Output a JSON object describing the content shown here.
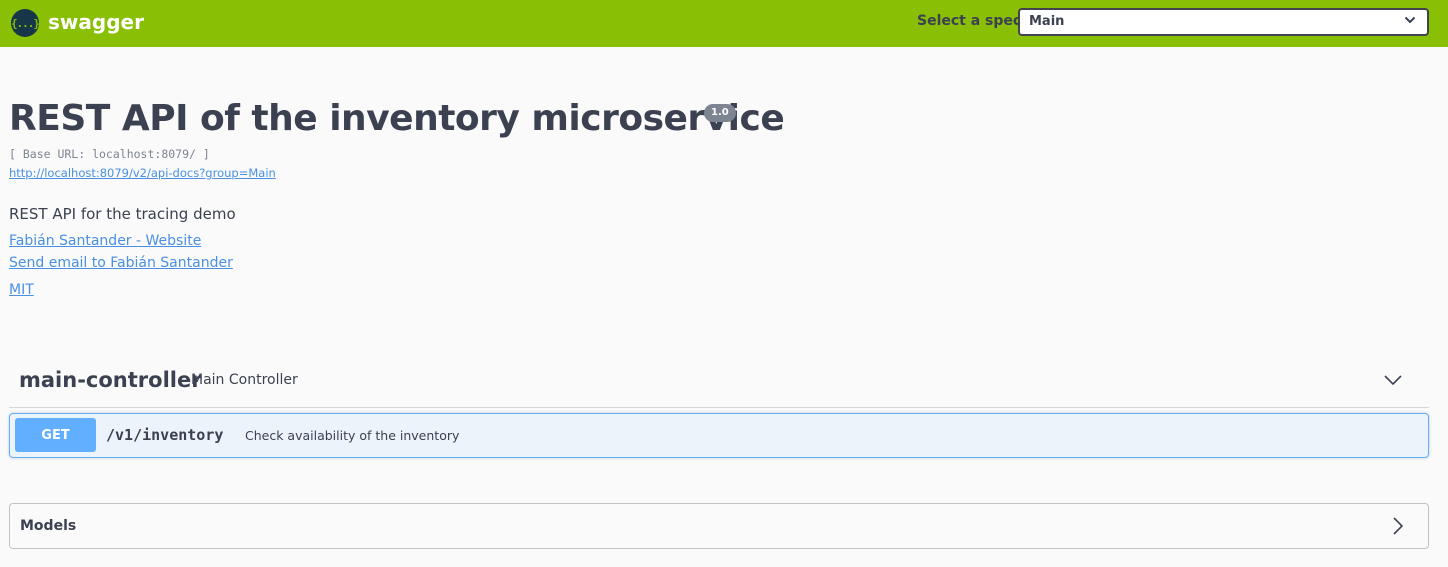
{
  "topbar": {
    "brand": "swagger",
    "logo_glyph": "{...}",
    "logo_icon": "swagger-logo-icon",
    "select_label": "Select a spec",
    "selected_spec": "Main",
    "background_color": "#89bf04"
  },
  "info": {
    "title": "REST API of the inventory microservice",
    "version": "1.0",
    "base_url": "[ Base URL: localhost:8079/ ]",
    "docs_url": "http://localhost:8079/v2/api-docs?group=Main",
    "description": "REST API for the tracing demo",
    "contact_website": "Fabián Santander - Website",
    "contact_email": "Send email to Fabián Santander",
    "license": "MIT"
  },
  "tag": {
    "name": "main-controller",
    "description": "Main Controller",
    "operations": [
      {
        "method": "GET",
        "path": "/v1/inventory",
        "summary": "Check availability of the inventory",
        "color": "#61affe"
      }
    ]
  },
  "models": {
    "title": "Models"
  }
}
